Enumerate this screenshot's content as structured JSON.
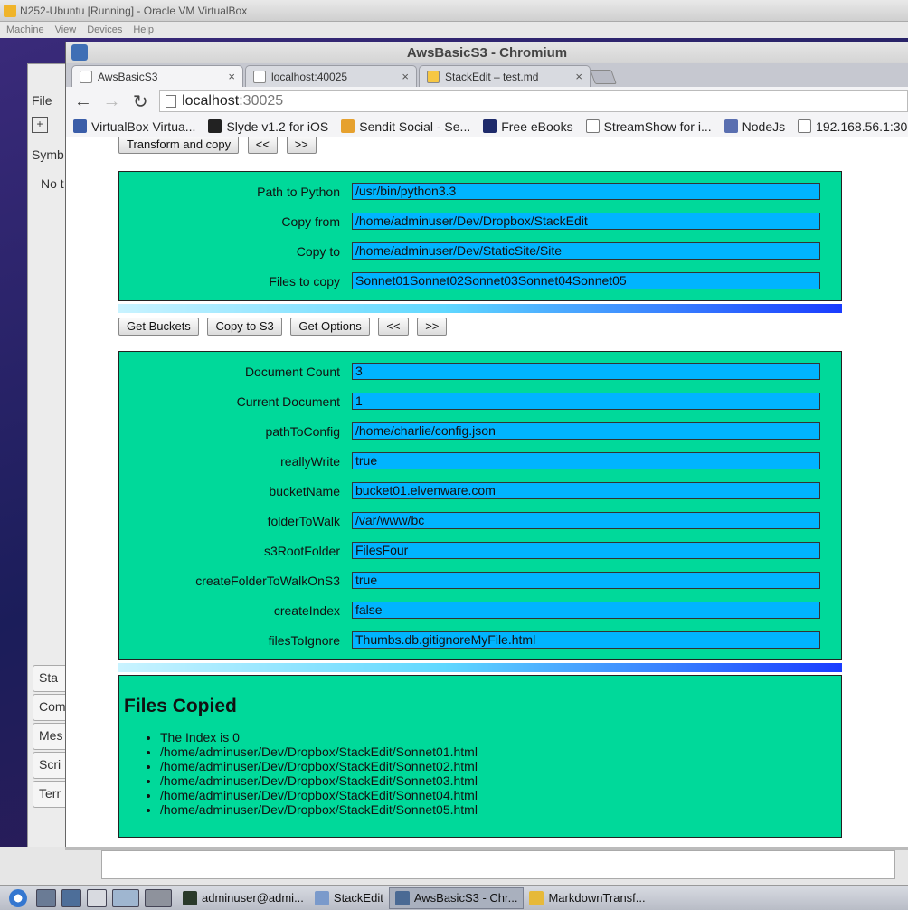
{
  "vbox": {
    "title": "N252-Ubuntu [Running] - Oracle VM VirtualBox",
    "menu": [
      "Machine",
      "View",
      "Devices",
      "Help"
    ]
  },
  "bg_app": {
    "file_label": "File",
    "symbols_label": "Symb",
    "no_label": "No t",
    "tabs": [
      "Sta",
      "Com",
      "Mes",
      "Scri",
      "Terr"
    ]
  },
  "browser": {
    "window_title": "AwsBasicS3 - Chromium",
    "tabs": [
      {
        "label": "AwsBasicS3",
        "close": "×"
      },
      {
        "label": "localhost:40025",
        "close": "×"
      },
      {
        "label": "StackEdit – test.md",
        "close": "×"
      }
    ],
    "url_host": "localhost",
    "url_port": ":30025",
    "bookmarks": [
      {
        "label": "VirtualBox Virtua...",
        "icon": "virtualbox-icon"
      },
      {
        "label": "Slyde v1.2 for iOS",
        "icon": "slyde-icon"
      },
      {
        "label": "Sendit Social - Se...",
        "icon": "sendit-icon"
      },
      {
        "label": "Free eBooks",
        "icon": "book-icon"
      },
      {
        "label": "StreamShow for i...",
        "icon": "page-icon"
      },
      {
        "label": "NodeJs",
        "icon": "nodejs-icon"
      },
      {
        "label": "192.168.56.1:30...",
        "icon": "page-icon"
      }
    ]
  },
  "page": {
    "top_buttons": {
      "transform": "Transform and copy",
      "prev": "<<",
      "next": ">>"
    },
    "python_panel": [
      {
        "label": "Path to Python",
        "value": "/usr/bin/python3.3"
      },
      {
        "label": "Copy from",
        "value": "/home/adminuser/Dev/Dropbox/StackEdit"
      },
      {
        "label": "Copy to",
        "value": "/home/adminuser/Dev/StaticSite/Site"
      },
      {
        "label": "Files to copy",
        "value": "Sonnet01Sonnet02Sonnet03Sonnet04Sonnet05"
      }
    ],
    "s3_buttons": {
      "get_buckets": "Get Buckets",
      "copy_to_s3": "Copy to S3",
      "get_options": "Get Options",
      "prev": "<<",
      "next": ">>"
    },
    "options_panel": [
      {
        "label": "Document Count",
        "value": "3"
      },
      {
        "label": "Current Document",
        "value": "1"
      },
      {
        "label": "pathToConfig",
        "value": "/home/charlie/config.json"
      },
      {
        "label": "reallyWrite",
        "value": "true"
      },
      {
        "label": "bucketName",
        "value": "bucket01.elvenware.com"
      },
      {
        "label": "folderToWalk",
        "value": "/var/www/bc"
      },
      {
        "label": "s3RootFolder",
        "value": "FilesFour"
      },
      {
        "label": "createFolderToWalkOnS3",
        "value": "true"
      },
      {
        "label": "createIndex",
        "value": "false"
      },
      {
        "label": "filesToIgnore",
        "value": "Thumbs.db.gitignoreMyFile.html"
      }
    ],
    "files_copied": {
      "heading": "Files Copied",
      "items": [
        "The Index is 0",
        "/home/adminuser/Dev/Dropbox/StackEdit/Sonnet01.html",
        "/home/adminuser/Dev/Dropbox/StackEdit/Sonnet02.html",
        "/home/adminuser/Dev/Dropbox/StackEdit/Sonnet03.html",
        "/home/adminuser/Dev/Dropbox/StackEdit/Sonnet04.html",
        "/home/adminuser/Dev/Dropbox/StackEdit/Sonnet05.html"
      ]
    }
  },
  "taskbar": {
    "tasks": [
      {
        "label": "adminuser@admi...",
        "icon": "terminal-icon"
      },
      {
        "label": "StackEdit",
        "icon": "folder-icon"
      },
      {
        "label": "AwsBasicS3 - Chr...",
        "icon": "chromium-icon",
        "active": true
      },
      {
        "label": "MarkdownTransf...",
        "icon": "app-icon"
      }
    ]
  },
  "colors": {
    "panel": "#00d99a",
    "field": "#00b4ff",
    "accent_bar_end": "#1a3cff"
  }
}
